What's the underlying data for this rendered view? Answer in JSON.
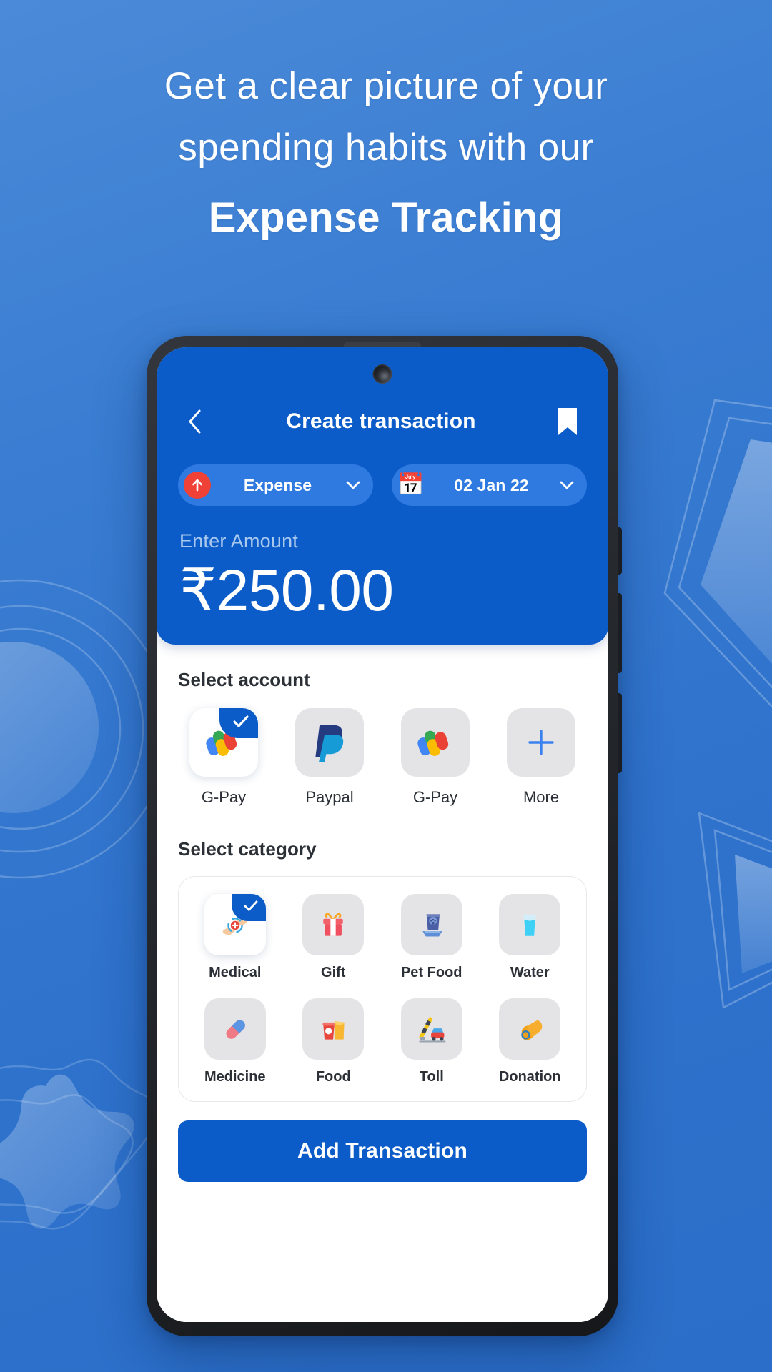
{
  "promo": {
    "line1": "Get a clear picture of your",
    "line2": "spending habits with our",
    "line3": "Expense Tracking"
  },
  "colors": {
    "brand_blue": "#0b5cc8",
    "background_blue": "#3a7dd2",
    "chip_blue": "#2f7ae0",
    "expense_red": "#ef4136",
    "tile_grey": "#e4e4e6",
    "amount_label": "#a9c8ee"
  },
  "appbar": {
    "back_icon": "chevron-left-icon",
    "title": "Create transaction",
    "bookmark_icon": "bookmark-icon"
  },
  "chips": {
    "type": {
      "icon": "arrow-up-icon",
      "label": "Expense",
      "caret": "chevron-down-icon"
    },
    "date": {
      "icon": "calendar-icon",
      "glyph": "📅",
      "label": "02 Jan 22",
      "caret": "chevron-down-icon"
    }
  },
  "amount": {
    "label": "Enter Amount",
    "value": "₹250.00",
    "currency": "₹",
    "number": "250.00"
  },
  "accounts": {
    "title": "Select account",
    "items": [
      {
        "label": "G-Pay",
        "icon": "gpay-icon",
        "selected": true
      },
      {
        "label": "Paypal",
        "icon": "paypal-icon",
        "selected": false
      },
      {
        "label": "G-Pay",
        "icon": "gpay-icon",
        "selected": false
      },
      {
        "label": "More",
        "icon": "plus-icon",
        "selected": false
      }
    ]
  },
  "categories": {
    "title": "Select category",
    "row1": [
      {
        "label": "Medical",
        "icon": "medical-hands-icon",
        "glyph": "",
        "selected": true
      },
      {
        "label": "Gift",
        "icon": "gift-icon",
        "glyph": "🎁",
        "selected": false
      },
      {
        "label": "Pet Food",
        "icon": "pet-food-icon",
        "glyph": "",
        "selected": false
      },
      {
        "label": "Water",
        "icon": "water-glass-icon",
        "glyph": "",
        "selected": false
      }
    ],
    "row2": [
      {
        "label": "Medicine",
        "icon": "pill-icon",
        "glyph": "💊",
        "selected": false
      },
      {
        "label": "Food",
        "icon": "food-icon",
        "glyph": "",
        "selected": false
      },
      {
        "label": "Toll",
        "icon": "toll-barrier-icon",
        "glyph": "",
        "selected": false
      },
      {
        "label": "Donation",
        "icon": "donation-icon",
        "glyph": "",
        "selected": false
      }
    ]
  },
  "cta": {
    "label": "Add Transaction"
  }
}
